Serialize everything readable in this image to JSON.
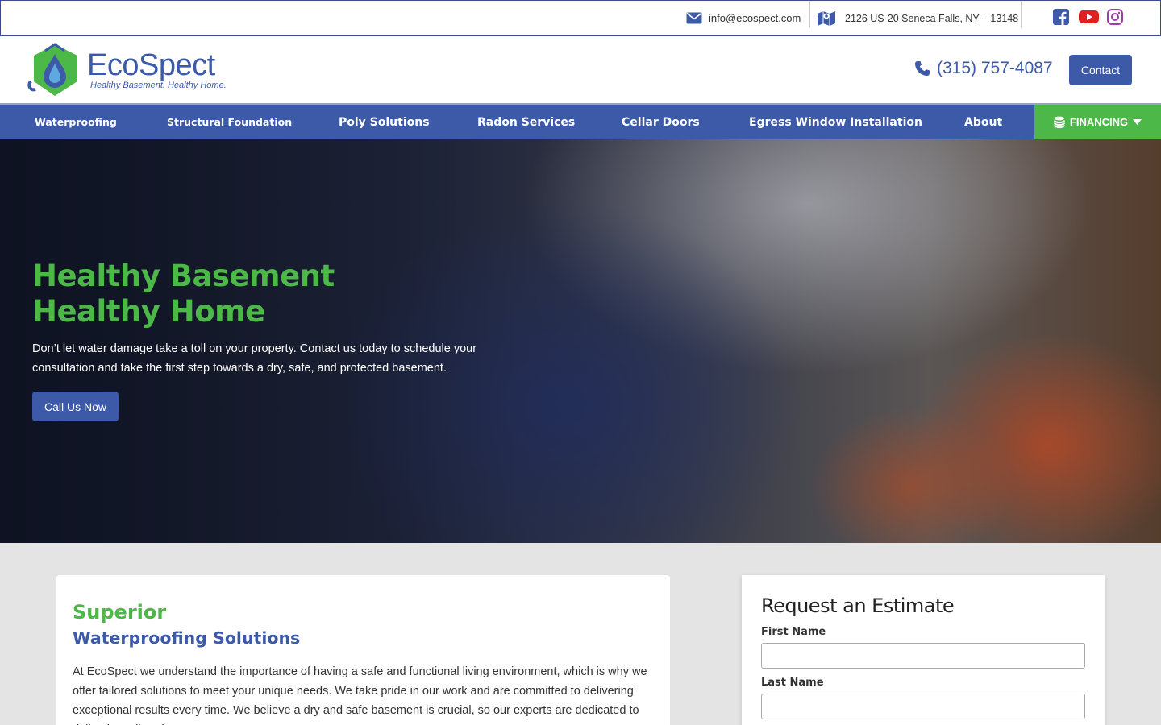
{
  "topbar": {
    "email": "info@ecospect.com",
    "address": "2126 US-20 Seneca Falls, NY – 13148",
    "social": [
      "facebook-icon",
      "youtube-icon",
      "instagram-icon"
    ]
  },
  "header": {
    "logo_name": "EcoSpect",
    "logo_tagline": "Healthy Basement. Healthy Home.",
    "phone": "(315) 757-4087",
    "contact_label": "Contact"
  },
  "nav": {
    "items": [
      "Waterproofing",
      "Structural Foundation",
      "Poly Solutions",
      "Radon Services",
      "Cellar Doors",
      "Egress Window Installation",
      "About"
    ],
    "financing": "FINANCING"
  },
  "hero": {
    "title_line1": "Healthy Basement",
    "title_line2": "Healthy Home",
    "text": "Don’t let water damage take a toll on your property. Contact us today to schedule your consultation and take the first step towards a dry, safe, and protected basement.",
    "button": "Call Us Now"
  },
  "intro": {
    "superior": "Superior",
    "subtitle": "Waterproofing Solutions",
    "body": "At EcoSpect we understand the importance of having a safe and functional living environment, which is why we offer tailored solutions to meet your unique needs. We take pride in our work and are committed to delivering exceptional results every time. We believe a dry and safe basement is crucial, so our experts are dedicated to delivering tailored"
  },
  "estimate": {
    "title": "Request an Estimate",
    "first_name_label": "First Name",
    "last_name_label": "Last Name"
  },
  "colors": {
    "brand_blue": "#3d5aa8",
    "brand_green": "#4cb848"
  }
}
